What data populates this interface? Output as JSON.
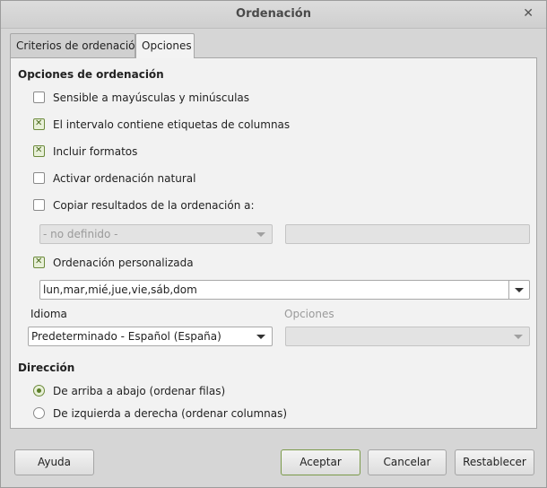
{
  "window": {
    "title": "Ordenación"
  },
  "tabs": [
    {
      "label": "Criterios de ordenación"
    },
    {
      "label": "Opciones"
    }
  ],
  "options_section": {
    "title": "Opciones de ordenación",
    "case_sensitive": {
      "label": "Sensible a mayúsculas y minúsculas",
      "checked": false
    },
    "has_headers": {
      "label": "El intervalo contiene etiquetas de columnas",
      "checked": true
    },
    "include_formats": {
      "label": "Incluir formatos",
      "checked": true
    },
    "natural_sort": {
      "label": "Activar ordenación natural",
      "checked": false
    },
    "copy_results": {
      "label": "Copiar resultados de la ordenación a:",
      "checked": false
    },
    "copy_target_select": {
      "value": "- no definido -"
    },
    "copy_target_input": {
      "value": ""
    },
    "custom_order": {
      "label": "Ordenación personalizada",
      "checked": true
    },
    "custom_order_select": {
      "value": "lun,mar,mié,jue,vie,sáb,dom"
    },
    "language_label": "Idioma",
    "language_select": {
      "value": "Predeterminado - Español (España)"
    },
    "options_label": "Opciones",
    "options_select": {
      "value": ""
    }
  },
  "direction_section": {
    "title": "Dirección",
    "top_to_bottom": {
      "label": "De arriba a abajo (ordenar filas)",
      "selected": true
    },
    "left_to_right": {
      "label": "De izquierda a derecha (ordenar columnas)",
      "selected": false
    }
  },
  "buttons": {
    "help": "Ayuda",
    "ok": "Aceptar",
    "cancel": "Cancelar",
    "reset": "Restablecer"
  },
  "colors": {
    "accent": "#6c8a3c",
    "panel_bg": "#f2f2f2",
    "window_bg": "#d6d6d6"
  },
  "icons": {
    "close": "close-icon",
    "dropdown": "chevron-down-icon"
  }
}
